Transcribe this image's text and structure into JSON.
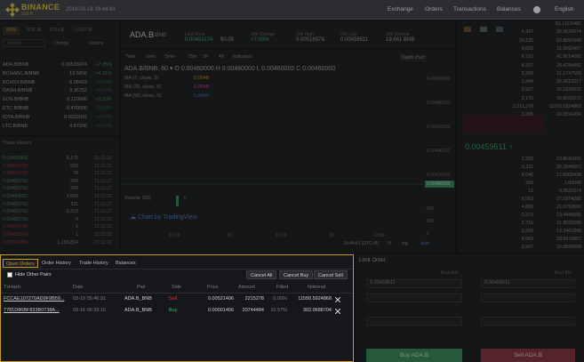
{
  "header": {
    "brand": "BINANCE",
    "brand_sub": "DEX",
    "datetime": "2019-03-18 16:44:43",
    "nav": [
      "Exchange",
      "Orders",
      "Transactions",
      "Balances"
    ],
    "language": "English"
  },
  "markets": {
    "tabs": [
      "BNB",
      "BTC.B",
      "ETH.B",
      "USDT.B"
    ],
    "search_placeholder": "Search",
    "filter_options": [
      "Change",
      "Volume"
    ],
    "rows": [
      {
        "pair": "ADA.B/BNB",
        "price": "0.00516974",
        "change": "+7.05%"
      },
      {
        "pair": "BCHABC.B/BNB",
        "price": "13.6856",
        "change": "+4.21%"
      },
      {
        "pair": "BCHSV.B/BNB",
        "price": "6.08423",
        "change": "+0.00%"
      },
      {
        "pair": "DASH.B/BNB",
        "price": "9.36752",
        "change": "+0.00%"
      },
      {
        "pair": "EOS.B/BNB",
        "price": "0.210906",
        "change": "+0.10%"
      },
      {
        "pair": "ETC.B/BNB",
        "price": "0.470000",
        "change": "+0.00%"
      },
      {
        "pair": "IOTA.B/BNB",
        "price": "0.0320916",
        "change": "+0.00%"
      },
      {
        "pair": "LTC.B/BNB",
        "price": "4.87000",
        "change": "+0.00%"
      }
    ]
  },
  "trade_history": {
    "title": "Trade History",
    "rows": [
      {
        "p": "0.00485968",
        "a": "6,175",
        "t": "21:11:22"
      },
      {
        "p": "0.00501752",
        "a": "922",
        "t": "21:11:22"
      },
      {
        "p": "0.00501752",
        "a": "78",
        "t": "21:11:22"
      },
      {
        "p": "0.00482769",
        "a": "239",
        "t": "21:11:22"
      },
      {
        "p": "0.00482769",
        "a": "250",
        "t": "21:11:22"
      },
      {
        "p": "0.00464837",
        "a": "3,000",
        "t": "21:11:22"
      },
      {
        "p": "0.00482769",
        "a": "511",
        "t": "21:11:22"
      },
      {
        "p": "0.00482769",
        "a": "5,313",
        "t": "21:11:22"
      },
      {
        "p": "0.00482769",
        "a": "9",
        "t": "21:11:22"
      },
      {
        "p": "0.00482769",
        "a": "1",
        "t": "21:11:22"
      },
      {
        "p": "0.00483976",
        "a": "1",
        "t": "21:11:22"
      },
      {
        "p": "0.00001456",
        "a": "1,183,814",
        "t": "21:11:22"
      }
    ]
  },
  "ticker": {
    "pair": "ADA.B",
    "quote": "/BNB",
    "stats": [
      {
        "label": "Last Price",
        "value": "0.00451174",
        "extra": "$0.05"
      },
      {
        "label": "24h Change",
        "value": "+7.05%"
      },
      {
        "label": "24h High",
        "value": "0.0051697&"
      },
      {
        "label": "24h Low",
        "value": "0.00459511"
      },
      {
        "label": "24h Volume",
        "value": "19,661 BNB"
      }
    ]
  },
  "chart": {
    "toolbar": [
      "Time",
      "1min",
      "5min",
      "15m",
      "1H",
      "4H",
      "Indicators"
    ],
    "depth_label": "Depth chart",
    "ohlc": "ADA.B/BNB, 60 ▾  O 0.00460000  H 0.00460000  L 0.00460000  C 0.00460000",
    "ma": [
      {
        "label": "MA (7, close, 0)",
        "value": "0.0048"
      },
      {
        "label": "MA (25, close, 0)",
        "value": "0.0048"
      },
      {
        "label": "MA (99, close, 0)",
        "value": "0.0049"
      }
    ],
    "price_ticks": [
      "0.00500000",
      "0.00480000",
      "0.00460000",
      "0.00440000",
      "0.00420000"
    ],
    "current_price": "0.00460000",
    "volume_label": "Volume (20)",
    "volume_value": "0",
    "watermark": "Chart by TradingView",
    "time_ticks": [
      "12:00",
      "18",
      "12:00",
      "18",
      "12:00"
    ],
    "footer": "16:44:43 (UTC+8)",
    "footer_opts": [
      "%",
      "log",
      "auto"
    ],
    "vol_ticks": [
      "360",
      "200",
      "0"
    ]
  },
  "orderbook": {
    "header": [
      "Price",
      "Amount",
      "Total"
    ],
    "asks": [
      {
        "p": "",
        "a": "",
        "t": "81,1121/482"
      },
      {
        "p": "",
        "a": "4,437",
        "t": "30.5620074"
      },
      {
        "p": "",
        "a": "16,125",
        "t": "93.8097008"
      },
      {
        "p": "",
        "a": "8,656",
        "t": "31.9992407"
      },
      {
        "p": "",
        "a": "6,720",
        "t": "41.8014600"
      },
      {
        "p": "",
        "a": "4,337",
        "t": "26.4784442"
      },
      {
        "p": "",
        "a": "3,350",
        "t": "21.1747509"
      },
      {
        "p": "",
        "a": "3,449",
        "t": "20.2610217"
      },
      {
        "p": "",
        "a": "2,937",
        "t": "16.1238632"
      },
      {
        "p": "",
        "a": "3,176",
        "t": "16.8103272"
      },
      {
        "p": "",
        "a": "2,211,278",
        "t": "11550.5924868"
      },
      {
        "p": "",
        "a": "3,205",
        "t": "16.5594294"
      }
    ],
    "mid_price": "0.00459511 ↑",
    "bids": [
      {
        "p": "",
        "a": "2,205",
        "t": "10.8041091"
      },
      {
        "p": "",
        "a": "5,311",
        "t": "26.1040661"
      },
      {
        "p": "",
        "a": "4,046",
        "t": "17.8302436"
      },
      {
        "p": "",
        "a": "250",
        "t": "1.00000"
      },
      {
        "p": "",
        "a": "12",
        "t": "0.0521674"
      },
      {
        "p": "",
        "a": "6,563",
        "t": "27.0974288"
      },
      {
        "p": "",
        "a": "4,850",
        "t": "21.0750000"
      },
      {
        "p": "",
        "a": "2,213",
        "t": "13.4448695"
      },
      {
        "p": "",
        "a": "2,716",
        "t": "11.8026588"
      },
      {
        "p": "",
        "a": "3,350",
        "t": "13.3461806"
      },
      {
        "p": "",
        "a": "4,963",
        "t": "18.8970957"
      },
      {
        "p": "",
        "a": "3,907",
        "t": "16.0599009"
      }
    ]
  },
  "place_order": {
    "title": "Limit Order",
    "buy_label": "Buy ADA.B",
    "sell_label": "Sell ADA.B",
    "best_ask": "Best Ask",
    "best_bid": "Best Bid",
    "buy_price": "0.00459511",
    "sell_price": "0.00459511"
  },
  "orders_modal": {
    "tabs": [
      "Open Orders",
      "Order History",
      "Trade History",
      "Balances"
    ],
    "hide_other_pairs": "Hide Other Pairs",
    "buttons": [
      "Cancel All",
      "Cancel Buy",
      "Cancel Sell"
    ],
    "columns": [
      "TxHash",
      "Date",
      "Pair",
      "Side",
      "Price",
      "Amount",
      "Filled",
      "Notional"
    ],
    "rows": [
      {
        "hash": "FCCAE107270AD9F9B59...",
        "date": "03-19 05:46:31",
        "pair": "ADA.B_BNB",
        "side": "Sell",
        "price": "0.00521406",
        "amount": "2215278",
        "filled": "0.00%",
        "notional": "11550.5924868"
      },
      {
        "hash": "7781D86BF833B0738A...",
        "date": "03-16 06:33:16",
        "pair": "ADA.B_BNB",
        "side": "Buy",
        "price": "0.00001456",
        "amount": "20744484",
        "filled": "10.57%",
        "notional": "302.0688704"
      }
    ]
  },
  "colors": {
    "accent": "#c99b1e",
    "buy": "#3fb56b",
    "sell": "#d9363e"
  }
}
